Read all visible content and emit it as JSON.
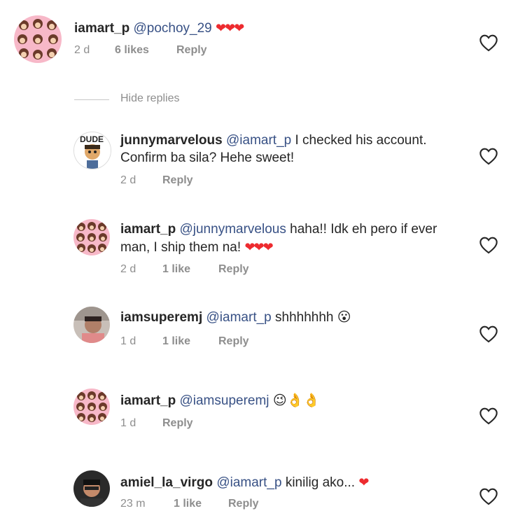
{
  "hide_replies_label": "Hide replies",
  "colors": {
    "mention": "#385185",
    "meta": "#8e8e8e",
    "heart": "#ed2b2f",
    "text": "#262626"
  },
  "comments": [
    {
      "username": "iamart_p",
      "mention": "@pochoy_29",
      "text": "",
      "text_line2": "",
      "trailing_emoji": "❤❤❤",
      "time": "2 d",
      "likes": "6 likes",
      "reply": "Reply",
      "avatar_icon": "pink-pattern-avatar"
    },
    {
      "username": "junnymarvelous",
      "mention": "@iamart_p",
      "text": "I checked his account.",
      "text_line2": "Confirm ba sila? Hehe sweet!",
      "trailing_emoji": "",
      "time": "2 d",
      "likes": "",
      "reply": "Reply",
      "avatar_icon": "dude-cartoon-avatar"
    },
    {
      "username": "iamart_p",
      "mention": "@junnymarvelous",
      "text": "haha!! Idk eh pero if ever",
      "text_line2": "man, I ship them na!",
      "trailing_emoji": "❤❤❤",
      "time": "2 d",
      "likes": "1 like",
      "reply": "Reply",
      "avatar_icon": "pink-pattern-avatar"
    },
    {
      "username": "iamsuperemj",
      "mention": "@iamart_p",
      "text": "shhhhhhh",
      "text_line2": "",
      "trailing_emoji": "😮",
      "time": "1 d",
      "likes": "1 like",
      "reply": "Reply",
      "avatar_icon": "photo-avatar"
    },
    {
      "username": "iamart_p",
      "mention": "@iamsuperemj",
      "text": "",
      "text_line2": "",
      "trailing_emoji": "😉👌👌",
      "time": "1 d",
      "likes": "",
      "reply": "Reply",
      "avatar_icon": "pink-pattern-avatar"
    },
    {
      "username": "amiel_la_virgo",
      "mention": "@iamart_p",
      "text": "kinilig ako...",
      "text_line2": "",
      "trailing_emoji": "❤",
      "time": "23 m",
      "likes": "1 like",
      "reply": "Reply",
      "avatar_icon": "photo-avatar"
    }
  ]
}
